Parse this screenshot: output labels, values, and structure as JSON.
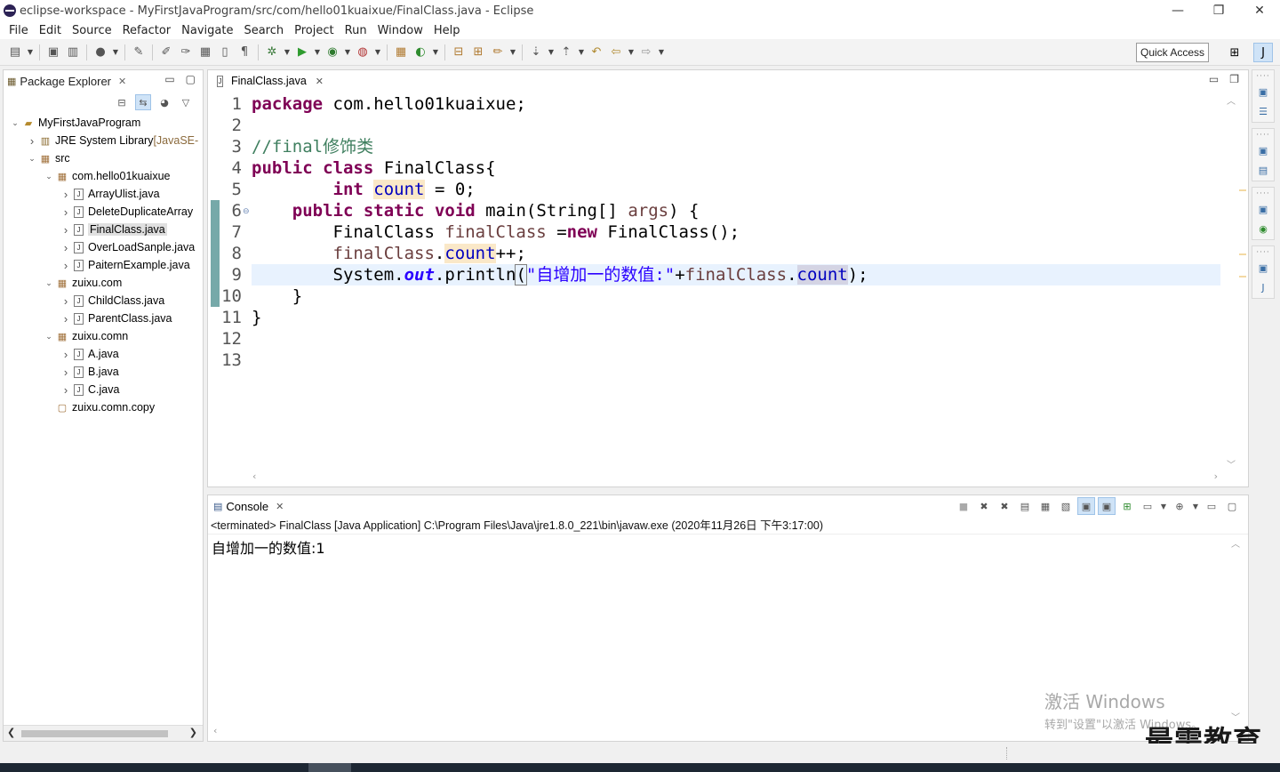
{
  "window": {
    "title": "eclipse-workspace - MyFirstJavaProgram/src/com/hello01kuaixue/FinalClass.java - Eclipse",
    "controls": [
      "—",
      "❐",
      "✕"
    ]
  },
  "menu": [
    "File",
    "Edit",
    "Source",
    "Refactor",
    "Navigate",
    "Search",
    "Project",
    "Run",
    "Window",
    "Help"
  ],
  "toolbar": {
    "quick_access": "Quick Access"
  },
  "package_explorer": {
    "title": "Package Explorer",
    "tree": [
      {
        "label": "MyFirstJavaProgram",
        "icon": "project-icon",
        "expanded": true,
        "depth": 0
      },
      {
        "label": "JRE System Library",
        "decoration": "[JavaSE-",
        "icon": "library-icon",
        "expanded": false,
        "depth": 1
      },
      {
        "label": "src",
        "icon": "source-folder-icon",
        "expanded": true,
        "depth": 1
      },
      {
        "label": "com.hello01kuaixue",
        "icon": "package-icon",
        "expanded": true,
        "depth": 2
      },
      {
        "label": "ArrayUlist.java",
        "icon": "java-file-icon",
        "depth": 3
      },
      {
        "label": "DeleteDuplicateArray",
        "icon": "java-file-icon",
        "depth": 3
      },
      {
        "label": "FinalClass.java",
        "icon": "java-file-icon",
        "depth": 3,
        "selected": true
      },
      {
        "label": "OverLoadSanple.java",
        "icon": "java-file-icon",
        "depth": 3
      },
      {
        "label": "PaiternExample.java",
        "icon": "java-file-icon",
        "depth": 3
      },
      {
        "label": "zuixu.com",
        "icon": "package-icon",
        "expanded": true,
        "depth": 2
      },
      {
        "label": "ChildClass.java",
        "icon": "java-file-icon",
        "depth": 3
      },
      {
        "label": "ParentClass.java",
        "icon": "java-file-icon",
        "depth": 3
      },
      {
        "label": "zuixu.comn",
        "icon": "package-icon",
        "expanded": true,
        "depth": 2
      },
      {
        "label": "A.java",
        "icon": "java-file-icon",
        "depth": 3
      },
      {
        "label": "B.java",
        "icon": "java-file-icon",
        "depth": 3
      },
      {
        "label": "C.java",
        "icon": "java-file-icon",
        "depth": 3
      },
      {
        "label": "zuixu.comn.copy",
        "icon": "empty-package-icon",
        "depth": 2
      }
    ]
  },
  "editor": {
    "tab": "FinalClass.java",
    "line_numbers": [
      "1",
      "2",
      "3",
      "4",
      "5",
      "6",
      "7",
      "8",
      "9",
      "10",
      "11",
      "12",
      "13"
    ],
    "code": {
      "l1_kw": "package",
      "l1_rest": " com.hello01kuaixue;",
      "l3_comment": "//final修饰类",
      "l4_kw1": "public",
      "l4_kw2": "class",
      "l4_rest": " FinalClass{",
      "l5_indent": "        ",
      "l5_kw": "int",
      "l5_field": "count",
      "l5_rest": " = 0;",
      "l6_indent": "    ",
      "l6_kw1": "public",
      "l6_kw2": "static",
      "l6_kw3": "void",
      "l6_name": " main(String[] ",
      "l6_param": "args",
      "l6_rest": ") {",
      "l7_indent": "        ",
      "l7_type": "FinalClass ",
      "l7_local": "finalClass",
      "l7_mid": " =",
      "l7_kw": "new",
      "l7_rest": " FinalClass();",
      "l8_indent": "        ",
      "l8_local": "finalClass",
      "l8_dot": ".",
      "l8_field": "count",
      "l8_rest": "++;",
      "l9_indent": "        ",
      "l9_sys": "System.",
      "l9_out": "out",
      "l9_call": ".println",
      "l9_paren": "(",
      "l9_str": "\"自增加一的数值:\"",
      "l9_plus": "+",
      "l9_local": "finalClass",
      "l9_dot": ".",
      "l9_field": "count",
      "l9_end": ");",
      "l10": "    }",
      "l11": "}"
    }
  },
  "console": {
    "title": "Console",
    "status": "<terminated> FinalClass [Java Application] C:\\Program Files\\Java\\jre1.8.0_221\\bin\\javaw.exe (2020年11月26日 下午3:17:00)",
    "output": "自增加一的数值:1"
  },
  "watermarks": {
    "activate_line1": "激活 Windows",
    "activate_line2": "转到\"设置\"以激活 Windows。",
    "logo": "最需教育"
  }
}
